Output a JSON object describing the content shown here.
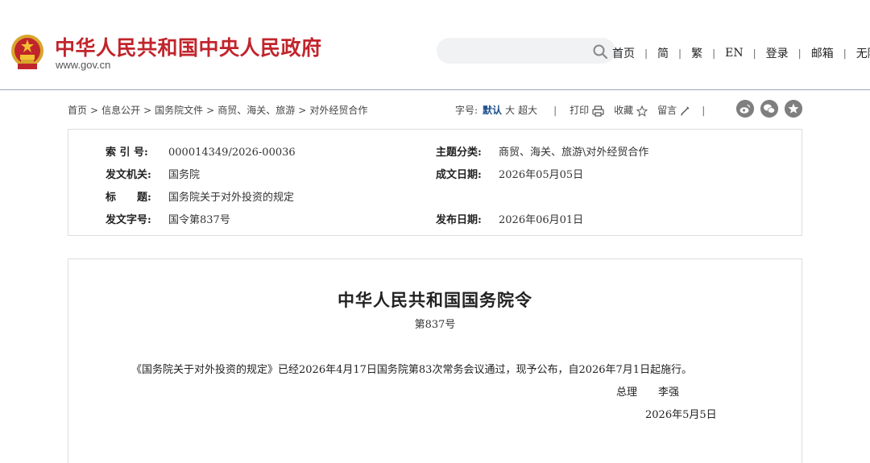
{
  "header": {
    "site_title": "中华人民共和国中央人民政府",
    "site_url": "www.gov.cn",
    "search_placeholder": "",
    "nav": [
      "首页",
      "简",
      "繁",
      "EN",
      "登录",
      "邮箱",
      "无障碍"
    ]
  },
  "breadcrumb": [
    "首页",
    "信息公开",
    "国务院文件",
    "商贸、海关、旅游",
    "对外经贸合作"
  ],
  "tools": {
    "font_size_label": "字号:",
    "font_default": "默认",
    "font_large": "大",
    "font_xlarge": "超大",
    "print": "打印",
    "favorite": "收藏",
    "comment": "留言"
  },
  "meta": {
    "index_no_label": "索 引 号:",
    "index_no": "000014349/2026-00036",
    "category_label": "主题分类:",
    "category": "商贸、海关、旅游\\对外经贸合作",
    "issuer_label": "发文机关:",
    "issuer": "国务院",
    "created_label": "成文日期:",
    "created": "2026年05月05日",
    "title_label": "标　　题:",
    "title": "国务院关于对外投资的规定",
    "doc_no_label": "发文字号:",
    "doc_no": "国令第837号",
    "published_label": "发布日期:",
    "published": "2026年06月01日"
  },
  "document": {
    "heading": "中华人民共和国国务院令",
    "number": "第837号",
    "body": "《国务院关于对外投资的规定》已经2026年4月17日国务院第83次常务会议通过，现予公布，自2026年7月1日起施行。",
    "signer_title": "总理",
    "signer_name": "李强",
    "date": "2026年5月5日"
  },
  "colors": {
    "brand_red": "#c1252c",
    "active_blue": "#1c4f8e",
    "social_grey": "#7f7f7f"
  },
  "icons": [
    "national-emblem-icon",
    "search-icon",
    "print-icon",
    "star-icon",
    "pencil-icon",
    "weibo-icon",
    "wechat-icon",
    "favorite-icon"
  ]
}
